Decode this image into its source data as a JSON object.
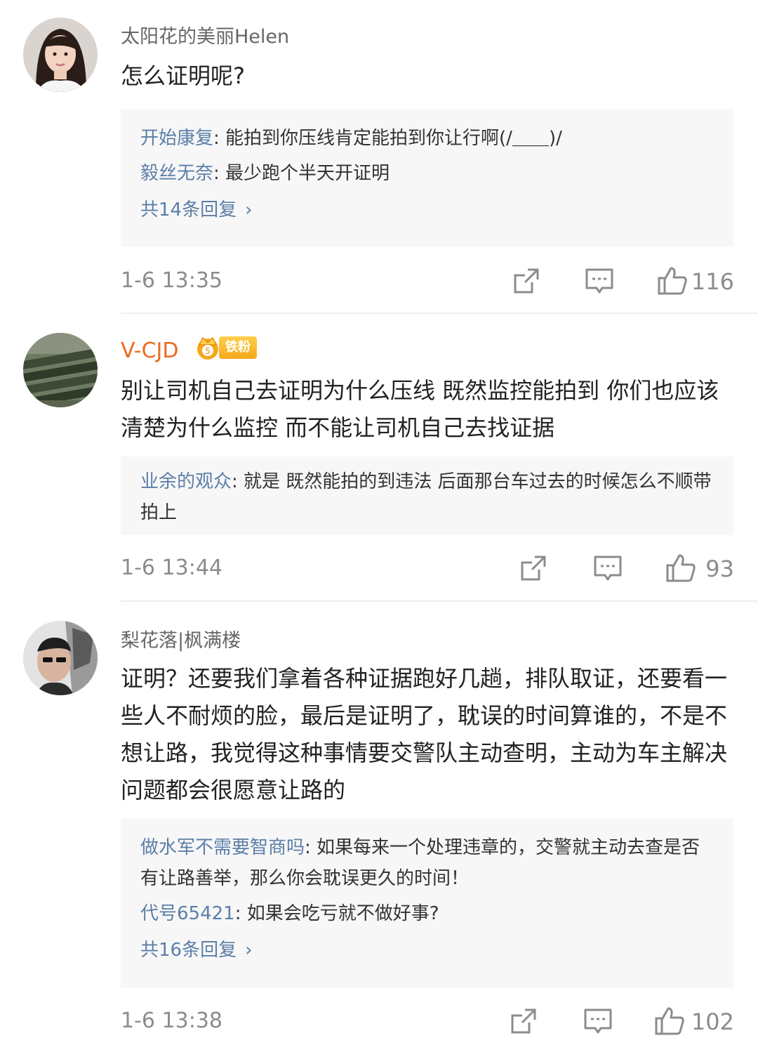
{
  "comments": [
    {
      "username": "太阳花的美丽Helen",
      "text": "怎么证明呢?",
      "replies": [
        {
          "name": "开始康复",
          "text": ": 能拍到你压线肯定能拍到你让行啊(/＿＿)/"
        },
        {
          "name": "毅丝无奈",
          "text": ": 最少跑个半天开证明"
        }
      ],
      "more": "共14条回复",
      "time": "1-6 13:35",
      "likes": "116"
    },
    {
      "username": "V-CJD",
      "badge": "铁粉",
      "text": "别让司机自己去证明为什么压线 既然监控能拍到 你们也应该清楚为什么监控 而不能让司机自己去找证据",
      "replies": [
        {
          "name": "业余的观众",
          "text": ": 就是  既然能拍的到违法 后面那台车过去的时候怎么不顺带拍上"
        }
      ],
      "time": "1-6 13:44",
      "likes": "93"
    },
    {
      "username": "梨花落|枫满楼",
      "text": "证明？还要我们拿着各种证据跑好几趟，排队取证，还要看一些人不耐烦的脸，最后是证明了，耽误的时间算谁的，不是不想让路，我觉得这种事情要交警队主动查明，主动为车主解决问题都会很愿意让路的",
      "replies": [
        {
          "name": "做水军不需要智商吗",
          "text": ": 如果每来一个处理违章的，交警就主动去查是否有让路善举，那么你会耽误更久的时间！"
        },
        {
          "name": "代号65421",
          "text": ": 如果会吃亏就不做好事?"
        }
      ],
      "more": "共16条回复",
      "time": "1-6 13:38",
      "likes": "102"
    }
  ],
  "icons": {
    "share": "share-icon",
    "comment": "comment-icon",
    "like": "thumbs-up-icon",
    "chevron": "chevron-right-icon"
  },
  "colors": {
    "link": "#5b7fa8",
    "vip_name": "#ec6a1f",
    "meta": "#8c8c8c",
    "reply_bg": "#f7f7f7"
  }
}
